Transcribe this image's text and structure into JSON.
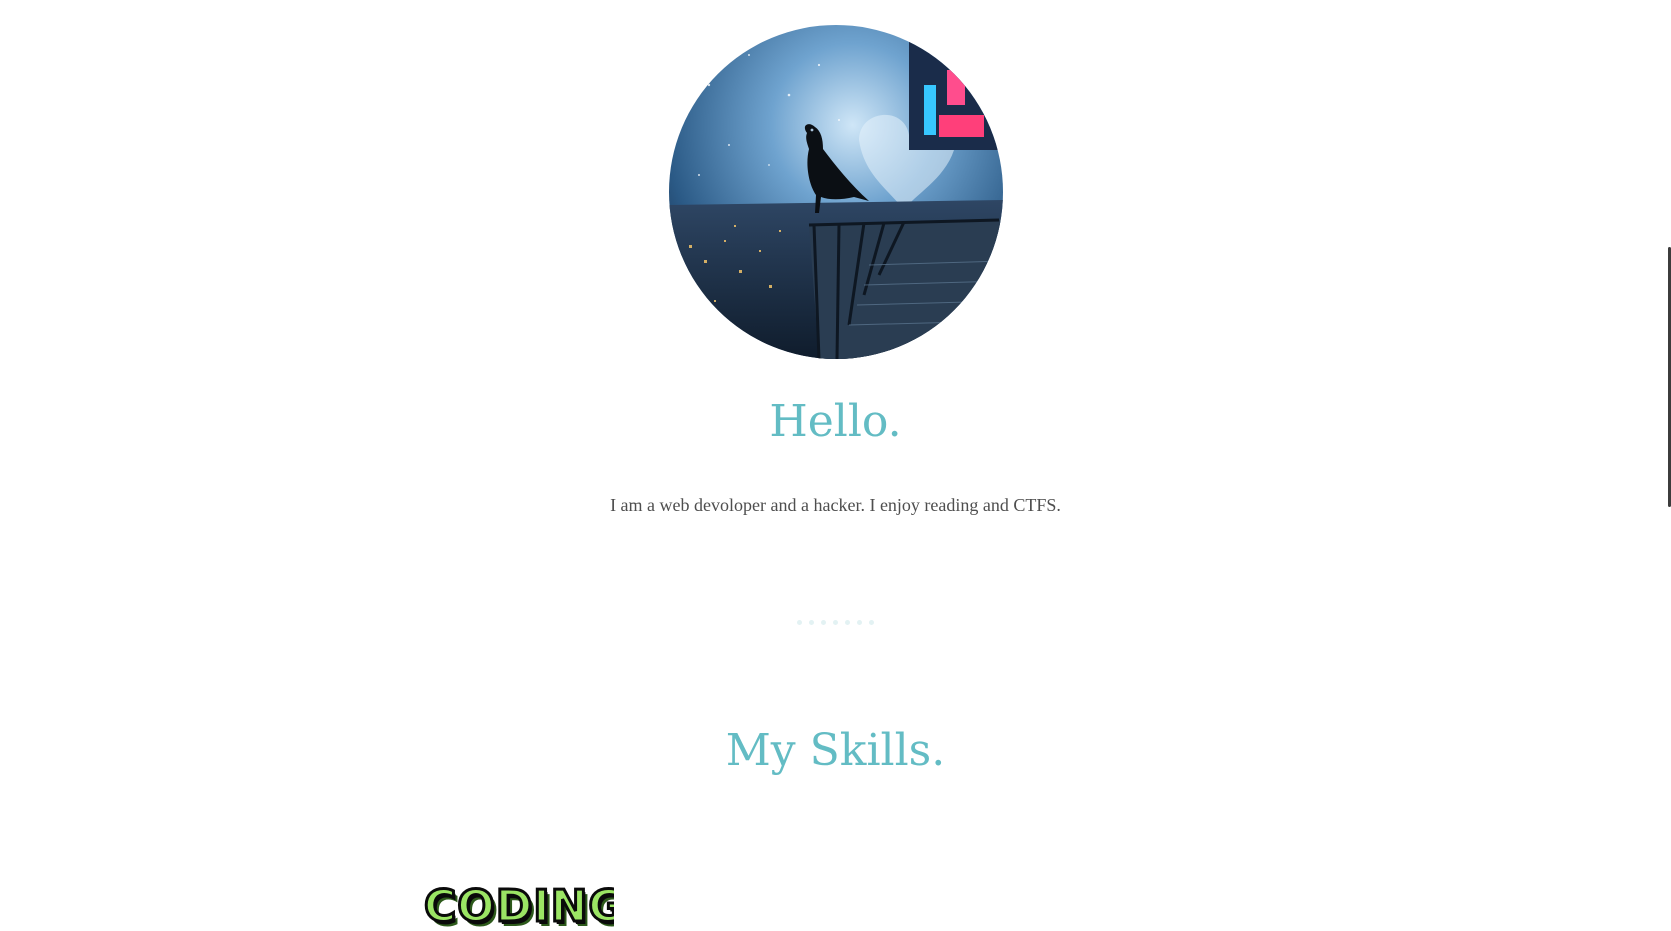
{
  "profile": {
    "avatar_icon": "raven-on-rooftop-photo"
  },
  "intro": {
    "heading": "Hello.",
    "text": "I am a web devoloper and a hacker. I enjoy reading and CTFS."
  },
  "divider": {
    "dot_count": 7
  },
  "skills": {
    "heading": "My Skills.",
    "items": [
      {
        "label": "CODING"
      }
    ]
  },
  "colors": {
    "accent": "#63bcc4",
    "body_text": "#4e4e4e",
    "divider_dot": "#e3f2f3",
    "coding_green": "#9be564"
  }
}
